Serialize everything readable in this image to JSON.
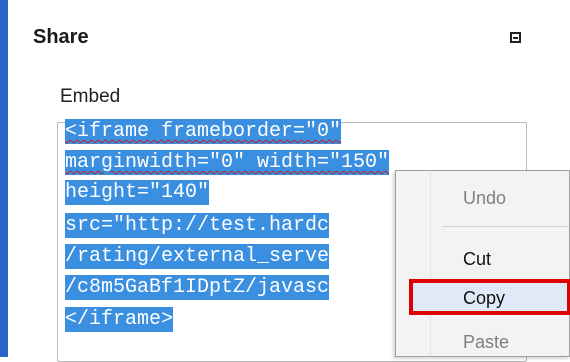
{
  "panel": {
    "title": "Share",
    "embed_label": "Embed",
    "embed_code": [
      "<iframe frameborder=\"0\"",
      "marginwidth=\"0\" width=\"150\"",
      "height=\"140\"",
      "src=\"http://test.hardc",
      "/rating/external_serve",
      "/c8m5GaBf1IDptZ/javasc",
      "</iframe>"
    ]
  },
  "context_menu": {
    "items": [
      {
        "label": "Undo",
        "state": "disabled"
      },
      {
        "label": "Cut",
        "state": "enabled"
      },
      {
        "label": "Copy",
        "state": "highlighted"
      },
      {
        "label": "Paste",
        "state": "disabled"
      }
    ]
  },
  "colors": {
    "selection": "#3a8fe0",
    "highlight_border": "#e00000",
    "window_border": "#2a64c8"
  },
  "icons": {
    "collapse": "collapse-icon"
  }
}
